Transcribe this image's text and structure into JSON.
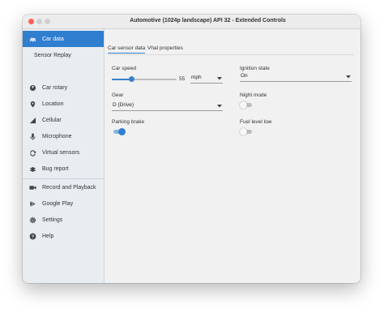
{
  "window": {
    "title": "Automotive (1024p landscape) API 32 - Extended Controls"
  },
  "sidebar": {
    "items": [
      {
        "label": "Car data",
        "icon": "car-icon",
        "active": true
      },
      {
        "label": "Sensor Replay",
        "icon": "",
        "sub": true
      },
      {
        "label": "Car rotary",
        "icon": "rotary-dial-icon"
      },
      {
        "label": "Location",
        "icon": "location-pin-icon"
      },
      {
        "label": "Cellular",
        "icon": "cellular-signal-icon"
      },
      {
        "label": "Microphone",
        "icon": "microphone-icon"
      },
      {
        "label": "Virtual sensors",
        "icon": "virtual-sensors-icon"
      },
      {
        "label": "Bug report",
        "icon": "bug-icon"
      },
      {
        "label": "Record and Playback",
        "icon": "video-camera-icon"
      },
      {
        "label": "Google Play",
        "icon": "google-play-icon"
      },
      {
        "label": "Settings",
        "icon": "gear-icon"
      },
      {
        "label": "Help",
        "icon": "help-icon"
      }
    ]
  },
  "tabs": [
    {
      "label": "Car sensor data",
      "active": true
    },
    {
      "label": "Vhal properties",
      "active": false
    }
  ],
  "controls": {
    "car_speed": {
      "label": "Car speed",
      "value": "55",
      "level": 0.3,
      "unit": "mph"
    },
    "ignition_state": {
      "label": "Ignition state",
      "value": "On"
    },
    "gear": {
      "label": "Gear",
      "value": "D (Drive)"
    },
    "night_mode": {
      "label": "Night mode",
      "on": false
    },
    "parking_brake": {
      "label": "Parking brake",
      "on": true
    },
    "fuel_level_low": {
      "label": "Fuel level low",
      "on": false
    }
  },
  "colors": {
    "accent": "#2f7ecf",
    "sidebar_bg": "#e8edf2",
    "window_bg": "#f1f1f1"
  }
}
